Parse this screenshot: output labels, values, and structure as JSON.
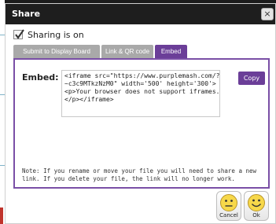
{
  "dialog": {
    "title": "Share",
    "close_label": "×"
  },
  "sharing": {
    "checked": true,
    "label": "Sharing is on"
  },
  "tabs": [
    {
      "label": "Submit to Display Board",
      "active": false
    },
    {
      "label": "Link & QR code",
      "active": false
    },
    {
      "label": "Embed",
      "active": true
    }
  ],
  "embed": {
    "label": "Embed:",
    "code": "<iframe src=\"https://www.purplemash.com/?\n~c3c9MTkzNzM0\" width='500' height='300'>\n<p>Your browser does not support iframes.\n</p></iframe>",
    "copy_label": "Copy"
  },
  "note": "Note: If you rename or move your file you will need to share a new link. If you delete your file, the link will no longer work.",
  "buttons": {
    "cancel_label": "Cancel",
    "ok_label": "Ok"
  },
  "colors": {
    "accent": "#6b3e98",
    "titlebar": "#1e1e1e",
    "tab_inactive": "#a9a9a9"
  }
}
